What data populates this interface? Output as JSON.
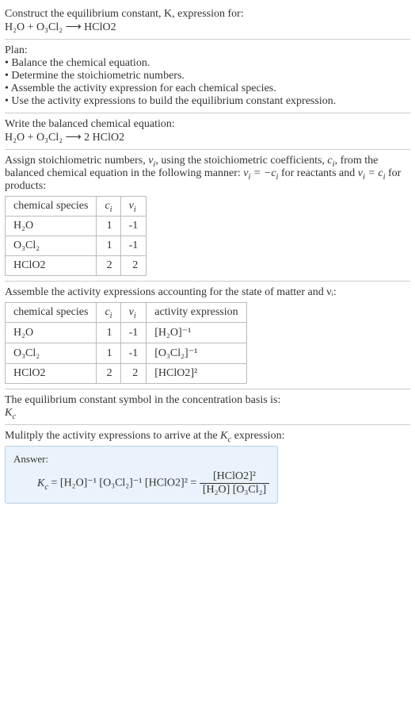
{
  "intro": {
    "line1": "Construct the equilibrium constant, K, expression for:",
    "equation": "H₂O + O₃Cl₂ ⟶ HClO2"
  },
  "plan": {
    "heading": "Plan:",
    "b1": "• Balance the chemical equation.",
    "b2": "• Determine the stoichiometric numbers.",
    "b3": "• Assemble the activity expression for each chemical species.",
    "b4": "• Use the activity expressions to build the equilibrium constant expression."
  },
  "balanced": {
    "heading": "Write the balanced chemical equation:",
    "equation": "H₂O + O₃Cl₂ ⟶ 2 HClO2"
  },
  "stoich": {
    "text_a": "Assign stoichiometric numbers, ",
    "text_b": ", using the stoichiometric coefficients, ",
    "text_c": ", from the balanced chemical equation in the following manner: ",
    "text_d": " for reactants and ",
    "text_e": " for products:",
    "head_species": "chemical species",
    "head_ci": "cᵢ",
    "head_vi": "νᵢ",
    "rows": [
      {
        "sp": "H₂O",
        "c": "1",
        "v": "-1"
      },
      {
        "sp": "O₃Cl₂",
        "c": "1",
        "v": "-1"
      },
      {
        "sp": "HClO2",
        "c": "2",
        "v": "2"
      }
    ]
  },
  "activity": {
    "heading": "Assemble the activity expressions accounting for the state of matter and νᵢ:",
    "head_species": "chemical species",
    "head_ci": "cᵢ",
    "head_vi": "νᵢ",
    "head_expr": "activity expression",
    "rows": [
      {
        "sp": "H₂O",
        "c": "1",
        "v": "-1",
        "expr": "[H₂O]⁻¹"
      },
      {
        "sp": "O₃Cl₂",
        "c": "1",
        "v": "-1",
        "expr": "[O₃Cl₂]⁻¹"
      },
      {
        "sp": "HClO2",
        "c": "2",
        "v": "2",
        "expr": "[HClO2]²"
      }
    ]
  },
  "symbol": {
    "line1": "The equilibrium constant symbol in the concentration basis is:",
    "line2": "K_c"
  },
  "mult": {
    "heading": "Mulitply the activity expressions to arrive at the K_c expression:"
  },
  "answer": {
    "label": "Answer:",
    "lhs": "K_c = [H₂O]⁻¹ [O₃Cl₂]⁻¹ [HClO2]² = ",
    "frac_num": "[HClO2]²",
    "frac_den": "[H₂O] [O₃Cl₂]"
  },
  "chart_data": {
    "type": "table",
    "tables": [
      {
        "columns": [
          "chemical species",
          "cᵢ",
          "νᵢ"
        ],
        "rows": [
          [
            "H₂O",
            1,
            -1
          ],
          [
            "O₃Cl₂",
            1,
            -1
          ],
          [
            "HClO2",
            2,
            2
          ]
        ]
      },
      {
        "columns": [
          "chemical species",
          "cᵢ",
          "νᵢ",
          "activity expression"
        ],
        "rows": [
          [
            "H₂O",
            1,
            -1,
            "[H₂O]⁻¹"
          ],
          [
            "O₃Cl₂",
            1,
            -1,
            "[O₃Cl₂]⁻¹"
          ],
          [
            "HClO2",
            2,
            2,
            "[HClO2]²"
          ]
        ]
      }
    ]
  }
}
